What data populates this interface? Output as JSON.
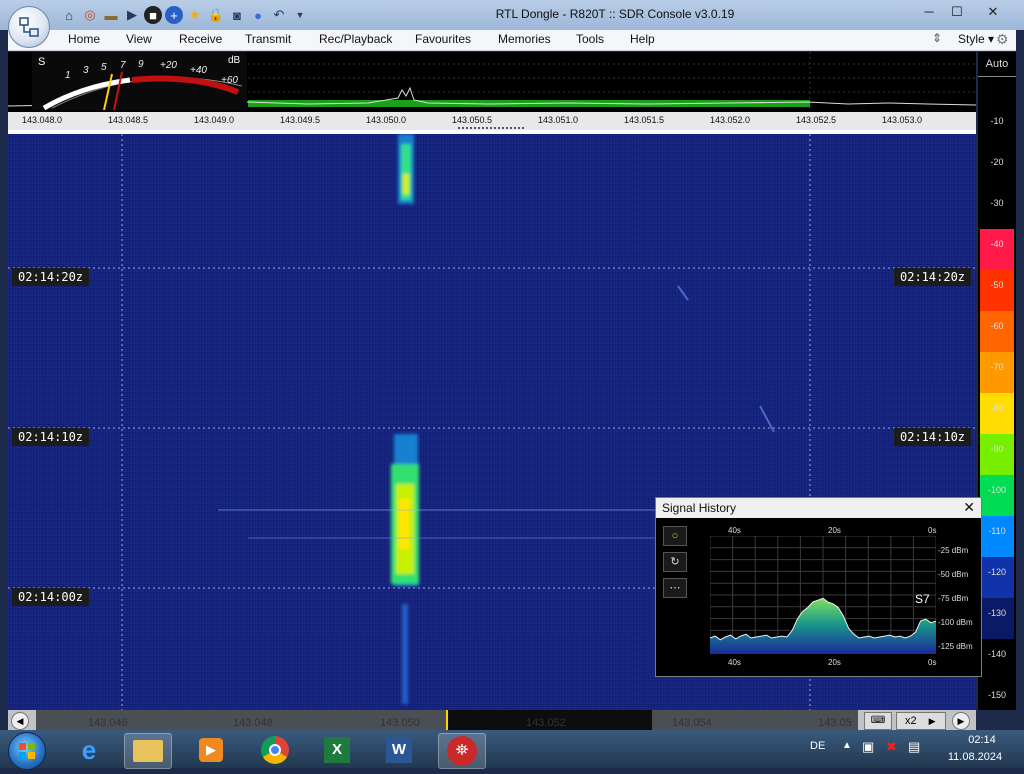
{
  "window": {
    "title": "RTL Dongle - R820T :: SDR Console v3.0.19",
    "minimize": "─",
    "maximize": "☐",
    "close": "✕"
  },
  "menu": {
    "items": [
      "Home",
      "View",
      "Receive",
      "Transmit",
      "Rec/Playback",
      "Favourites",
      "Memories",
      "Tools",
      "Help"
    ],
    "style_label": "Style"
  },
  "smeter": {
    "s_label": "S",
    "db_label": "dB",
    "s_scale": [
      "1",
      "3",
      "5",
      "7",
      "9"
    ],
    "db_scale": [
      "+20",
      "+40",
      "+60"
    ]
  },
  "frequency_axis": {
    "labels": [
      "143.048.0",
      "143.048.5",
      "143.049.0",
      "143.049.5",
      "143.050.0",
      "143.050.5",
      "143.051.0",
      "143.051.5",
      "143.052.0",
      "143.052.5",
      "143.053.0"
    ]
  },
  "waterfall": {
    "time_marks": [
      "02:14:20z",
      "02:14:10z",
      "02:14:00z"
    ]
  },
  "right_scale": {
    "auto_label": "Auto",
    "values": [
      "-10",
      "-20",
      "-30",
      "-40",
      "-50",
      "-60",
      "-70",
      "-80",
      "-90",
      "-100",
      "-110",
      "-120",
      "-130",
      "-140",
      "-150"
    ],
    "colors": {
      "-40": "#ff1a4a",
      "-50": "#ff3300",
      "-60": "#ff6600",
      "-70": "#ff9900",
      "-80": "#ffdd00",
      "-90": "#77ee00",
      "-100": "#00dd55",
      "-110": "#0088ff",
      "-120": "#1133aa",
      "-130": "#0a1a66"
    }
  },
  "bottom_axis": {
    "labels": [
      "143.046",
      "143.048",
      "143.050",
      "143.052",
      "143.054",
      "143.05"
    ],
    "zoom": "x2"
  },
  "signal_history": {
    "title": "Signal History",
    "close": "✕",
    "top_time_labels": [
      "40s",
      "20s",
      "0s"
    ],
    "bottom_time_labels": [
      "40s",
      "20s",
      "0s"
    ],
    "dbm_labels": [
      "-25 dBm",
      "-50 dBm",
      "-75 dBm",
      "-100 dBm",
      "-125 dBm"
    ],
    "current_s": "S7",
    "tool_buttons": [
      "○",
      "↻",
      "⋯"
    ],
    "history_dbm": [
      -118,
      -116,
      -120,
      -117,
      -115,
      -119,
      -116,
      -114,
      -118,
      -117,
      -116,
      -115,
      -118,
      -117,
      -116,
      -117,
      -110,
      -98,
      -90,
      -86,
      -80,
      -78,
      -76,
      -80,
      -82,
      -86,
      -95,
      -108,
      -114,
      -118,
      -117,
      -116,
      -118,
      -117,
      -116,
      -115,
      -117,
      -116,
      -118,
      -116,
      -112,
      -100,
      -98,
      -102,
      -100
    ]
  },
  "taskbar": {
    "language": "DE",
    "time": "02:14",
    "date": "11.08.2024"
  }
}
